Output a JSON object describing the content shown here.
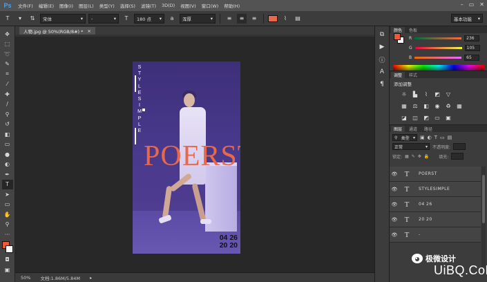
{
  "app": {
    "logo": "Ps"
  },
  "menu": [
    "文件(F)",
    "编辑(E)",
    "图像(I)",
    "图层(L)",
    "类型(Y)",
    "选择(S)",
    "滤镜(T)",
    "3D(D)",
    "视图(V)",
    "窗口(W)",
    "帮助(H)"
  ],
  "window_controls": [
    "–",
    "▭",
    "✕"
  ],
  "options": {
    "font_family": "宋体",
    "font_style": "-",
    "font_size": "180 点",
    "aa_label": "a",
    "aa_mode": "浑厚",
    "text_color": "#e8684a",
    "workspace": "基本功能"
  },
  "document": {
    "tab_label": "人物.jpg @ 50%(RGB/8#) *",
    "close": "×"
  },
  "artwork": {
    "vertical_letters": [
      "S",
      "T",
      "Y",
      "L",
      "E",
      "S",
      "I",
      "M",
      "P",
      "L",
      "E"
    ],
    "title": "POERST",
    "date_line1": "04 26",
    "date_line2": "20 20",
    "title_color": "#e8684a",
    "background_color": "#4a3a8e"
  },
  "status": {
    "zoom": "50%",
    "doc": "文档:1.86M/5.84M"
  },
  "color_panel": {
    "tabs": [
      "颜色",
      "色板"
    ],
    "fg": "#ec5a3c",
    "r_label": "R",
    "r": "236",
    "g_label": "G",
    "g": "105",
    "b_label": "B",
    "b": "65"
  },
  "adjust_panel": {
    "tabs": [
      "调整",
      "样式"
    ],
    "title": "添加调整"
  },
  "layers_panel": {
    "tabs": [
      "图层",
      "通道",
      "路径"
    ],
    "filter": "类型",
    "blend": "正常",
    "opacity_label": "不透明度:",
    "lock_label": "锁定:",
    "fill_label": "填充:",
    "layers": [
      {
        "name": "POERST"
      },
      {
        "name": "STYLESIMPLE"
      },
      {
        "name": "04 26"
      },
      {
        "name": "20 20"
      },
      {
        "name": "-"
      }
    ]
  },
  "watermark": {
    "text": "极微设计",
    "site": "UiBQ.CoM"
  }
}
